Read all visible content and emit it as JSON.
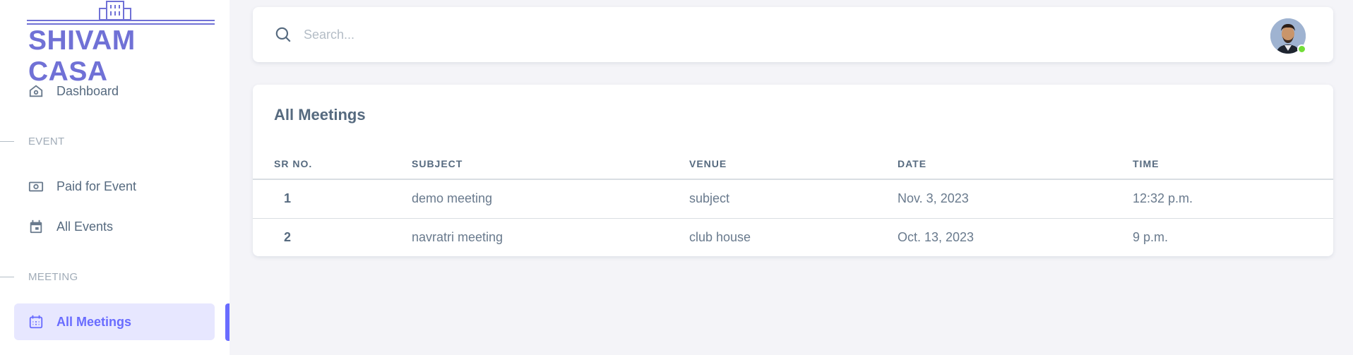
{
  "brand": {
    "name": "SHIVAM CASA",
    "accent": "#696cff"
  },
  "sidebar": {
    "items": [
      {
        "label": "Dashboard",
        "icon": "home-icon"
      },
      {
        "section": "EVENT"
      },
      {
        "label": "Paid for Event",
        "icon": "money-icon"
      },
      {
        "label": "All Events",
        "icon": "calendar-icon"
      },
      {
        "section": "MEETING"
      },
      {
        "label": "All Meetings",
        "icon": "calendar-grid-icon",
        "active": true
      }
    ]
  },
  "search": {
    "placeholder": "Search..."
  },
  "user": {
    "status": "online",
    "status_color": "#71dd37"
  },
  "meetings": {
    "title": "All Meetings",
    "columns": [
      "SR NO.",
      "SUBJECT",
      "VENUE",
      "DATE",
      "TIME"
    ],
    "rows": [
      [
        "1",
        "demo meeting",
        "subject",
        "Nov. 3, 2023",
        "12:32 p.m."
      ],
      [
        "2",
        "navratri meeting",
        "club house",
        "Oct. 13, 2023",
        "9 p.m."
      ]
    ]
  }
}
